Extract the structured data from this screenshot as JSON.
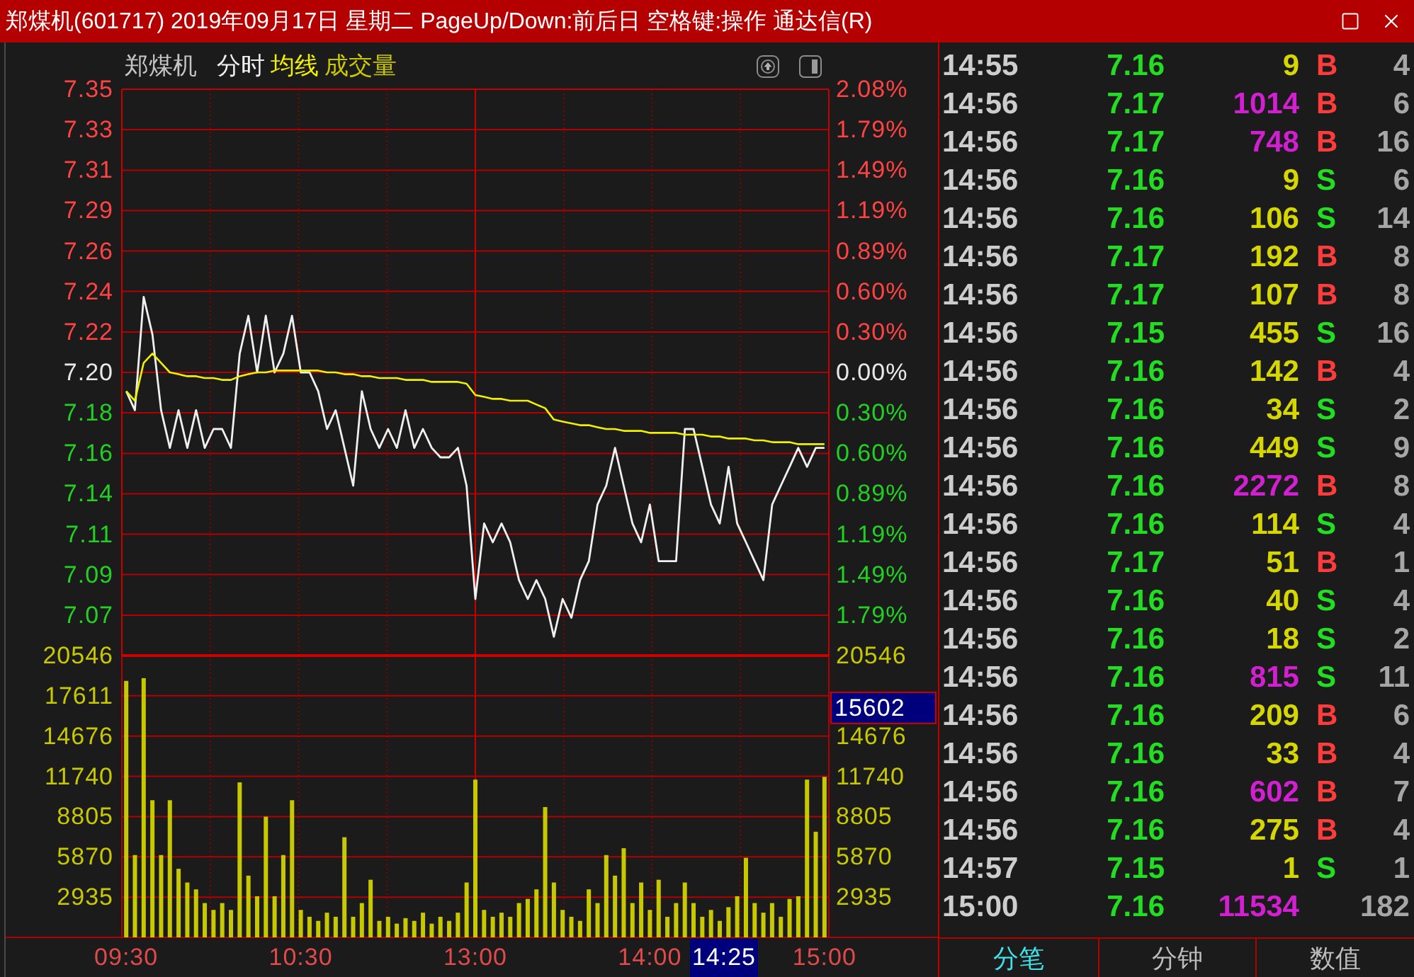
{
  "window": {
    "title": "郑煤机(601717) 2019年09月17日 星期二 PageUp/Down:前后日 空格键:操作 通达信(R)"
  },
  "chart_header": {
    "stock_name": "郑煤机"
  },
  "price_chart": {
    "chart_data": {
      "type": "line",
      "grid": true,
      "categories": [
        null,
        null,
        null,
        null,
        null,
        null,
        null,
        null,
        null,
        null,
        null,
        null,
        null,
        null,
        null,
        null,
        null,
        null,
        null,
        null,
        null,
        null,
        null,
        null,
        null,
        null,
        null,
        null,
        null,
        null,
        null,
        null,
        null,
        null,
        null,
        null,
        null,
        null,
        null,
        null,
        null,
        null,
        null,
        null,
        null,
        null,
        null,
        null,
        null,
        null,
        null,
        null,
        null,
        null,
        null,
        null,
        null,
        null,
        null,
        null,
        null,
        null,
        null,
        null,
        null,
        null,
        null,
        null,
        null,
        null,
        null,
        null,
        null,
        null,
        null,
        null,
        null,
        null,
        null,
        null,
        null
      ],
      "ylim": [
        7.05,
        7.35
      ],
      "yticks": [
        {
          "value": 7.35,
          "label": "7.35"
        },
        {
          "value": 7.3286,
          "label": "7.33"
        },
        {
          "value": 7.3071,
          "label": "7.31"
        },
        {
          "value": 7.2857,
          "label": "7.29"
        },
        {
          "value": 7.2643,
          "label": "7.26"
        },
        {
          "value": 7.2429,
          "label": "7.24"
        },
        {
          "value": 7.2214,
          "label": "7.22"
        },
        {
          "value": 7.2,
          "label": "7.20"
        },
        {
          "value": 7.1786,
          "label": "7.18"
        },
        {
          "value": 7.1571,
          "label": "7.16"
        },
        {
          "value": 7.1357,
          "label": "7.14"
        },
        {
          "value": 7.1143,
          "label": "7.11"
        },
        {
          "value": 7.0929,
          "label": "7.09"
        },
        {
          "value": 7.0714,
          "label": "7.07"
        }
      ],
      "series": [
        {
          "name": "分时",
          "color": "#f0f0f0",
          "values": [
            7.19,
            7.18,
            7.24,
            7.22,
            7.18,
            7.16,
            7.18,
            7.16,
            7.18,
            7.16,
            7.17,
            7.17,
            7.16,
            7.21,
            7.23,
            7.2,
            7.23,
            7.2,
            7.21,
            7.23,
            7.2,
            7.2,
            7.19,
            7.17,
            7.18,
            7.16,
            7.14,
            7.19,
            7.17,
            7.16,
            7.17,
            7.16,
            7.18,
            7.16,
            7.17,
            7.16,
            7.155,
            7.155,
            7.16,
            7.14,
            7.08,
            7.12,
            7.11,
            7.12,
            7.11,
            7.09,
            7.08,
            7.09,
            7.08,
            7.06,
            7.08,
            7.07,
            7.09,
            7.1,
            7.13,
            7.14,
            7.16,
            7.14,
            7.12,
            7.11,
            7.13,
            7.1,
            7.1,
            7.1,
            7.17,
            7.17,
            7.15,
            7.13,
            7.12,
            7.15,
            7.12,
            7.11,
            7.1,
            7.09,
            7.13,
            7.14,
            7.15,
            7.16,
            7.15,
            7.16,
            7.16
          ]
        },
        {
          "name": "均线",
          "color": "#f0f000",
          "values": [
            7.19,
            7.185,
            7.205,
            7.21,
            7.205,
            7.2,
            7.199,
            7.198,
            7.198,
            7.197,
            7.197,
            7.196,
            7.196,
            7.198,
            7.199,
            7.2,
            7.2,
            7.201,
            7.201,
            7.201,
            7.201,
            7.201,
            7.201,
            7.2,
            7.2,
            7.199,
            7.199,
            7.198,
            7.198,
            7.197,
            7.197,
            7.197,
            7.196,
            7.196,
            7.196,
            7.195,
            7.195,
            7.195,
            7.195,
            7.194,
            7.188,
            7.187,
            7.186,
            7.186,
            7.185,
            7.185,
            7.185,
            7.183,
            7.181,
            7.175,
            7.174,
            7.173,
            7.172,
            7.172,
            7.171,
            7.17,
            7.17,
            7.169,
            7.169,
            7.169,
            7.168,
            7.168,
            7.168,
            7.168,
            7.167,
            7.167,
            7.167,
            7.166,
            7.166,
            7.165,
            7.165,
            7.165,
            7.164,
            7.164,
            7.163,
            7.163,
            7.163,
            7.162,
            7.162,
            7.162,
            7.162
          ]
        }
      ]
    },
    "percent_labels": [
      {
        "text": "2.08%",
        "kind": "up"
      },
      {
        "text": "1.79%",
        "kind": "up"
      },
      {
        "text": "1.49%",
        "kind": "up"
      },
      {
        "text": "1.19%",
        "kind": "up"
      },
      {
        "text": "0.89%",
        "kind": "up"
      },
      {
        "text": "0.60%",
        "kind": "up"
      },
      {
        "text": "0.30%",
        "kind": "up"
      },
      {
        "text": "0.00%",
        "kind": "base"
      },
      {
        "text": "0.30%",
        "kind": "down"
      },
      {
        "text": "0.60%",
        "kind": "down"
      },
      {
        "text": "0.89%",
        "kind": "down"
      },
      {
        "text": "1.19%",
        "kind": "down"
      },
      {
        "text": "1.49%",
        "kind": "down"
      },
      {
        "text": "1.79%",
        "kind": "down"
      }
    ]
  },
  "volume_chart": {
    "chart_data": {
      "type": "bar",
      "grid": true,
      "categories": [
        "09:30",
        null,
        null,
        null,
        null,
        null,
        null,
        null,
        null,
        null,
        null,
        null,
        null,
        null,
        null,
        null,
        null,
        null,
        null,
        null,
        "10:30",
        null,
        null,
        null,
        null,
        null,
        null,
        null,
        null,
        null,
        null,
        null,
        null,
        null,
        null,
        null,
        null,
        null,
        null,
        null,
        "13:00",
        null,
        null,
        null,
        null,
        null,
        null,
        null,
        null,
        null,
        null,
        null,
        null,
        null,
        null,
        null,
        null,
        null,
        null,
        null,
        "14:00",
        null,
        null,
        null,
        null,
        null,
        null,
        null,
        null,
        null,
        null,
        null,
        null,
        null,
        null,
        null,
        null,
        null,
        null,
        null,
        "15:00"
      ],
      "ylim": [
        0,
        20546
      ],
      "yticks": [
        20546,
        17611,
        14676,
        11740,
        8805,
        5870,
        2935
      ],
      "series": [
        {
          "name": "成交量",
          "color": "#c8c800",
          "values": [
            18700,
            6000,
            18900,
            10000,
            6000,
            10000,
            5000,
            4000,
            3500,
            2500,
            2000,
            2500,
            2000,
            11300,
            4500,
            3000,
            8800,
            3000,
            6000,
            10000,
            2000,
            1500,
            1200,
            1800,
            1500,
            7300,
            1500,
            2500,
            4200,
            1200,
            1500,
            1000,
            1400,
            1200,
            1800,
            1000,
            1500,
            1200,
            1800,
            4000,
            11500,
            2000,
            1500,
            1800,
            1500,
            2500,
            2800,
            3500,
            9500,
            4000,
            2000,
            1500,
            1200,
            3500,
            2500,
            6000,
            4500,
            6500,
            2500,
            4000,
            2000,
            4200,
            1500,
            2500,
            4000,
            2500,
            1500,
            2000,
            1200,
            2200,
            3000,
            5800,
            2500,
            1800,
            2500,
            1500,
            2800,
            3000,
            11500,
            7700,
            11700
          ]
        }
      ]
    },
    "right_axis": [
      {
        "kind": "label",
        "text": "20546"
      },
      {
        "kind": "cursor",
        "text": "15602"
      },
      {
        "kind": "label",
        "text": "14676"
      },
      {
        "kind": "label",
        "text": "11740"
      },
      {
        "kind": "label",
        "text": "8805"
      },
      {
        "kind": "label",
        "text": "5870"
      },
      {
        "kind": "label",
        "text": "2935"
      }
    ],
    "cursor_time": "14:25"
  },
  "trades": [
    {
      "time": "14:55",
      "price": "7.16",
      "volume": "9",
      "large": false,
      "side": "B",
      "color": "#ff3c3c",
      "count": "4"
    },
    {
      "time": "14:56",
      "price": "7.17",
      "volume": "1014",
      "large": true,
      "side": "B",
      "color": "#ff3c3c",
      "count": "6"
    },
    {
      "time": "14:56",
      "price": "7.17",
      "volume": "748",
      "large": true,
      "side": "B",
      "color": "#ff3c3c",
      "count": "16"
    },
    {
      "time": "14:56",
      "price": "7.16",
      "volume": "9",
      "large": false,
      "side": "S",
      "color": "#22dd22",
      "count": "6"
    },
    {
      "time": "14:56",
      "price": "7.16",
      "volume": "106",
      "large": false,
      "side": "S",
      "color": "#22dd22",
      "count": "14"
    },
    {
      "time": "14:56",
      "price": "7.17",
      "volume": "192",
      "large": false,
      "side": "B",
      "color": "#ff3c3c",
      "count": "8"
    },
    {
      "time": "14:56",
      "price": "7.17",
      "volume": "107",
      "large": false,
      "side": "B",
      "color": "#ff3c3c",
      "count": "8"
    },
    {
      "time": "14:56",
      "price": "7.15",
      "volume": "455",
      "large": false,
      "side": "S",
      "color": "#22dd22",
      "count": "16"
    },
    {
      "time": "14:56",
      "price": "7.16",
      "volume": "142",
      "large": false,
      "side": "B",
      "color": "#ff3c3c",
      "count": "4"
    },
    {
      "time": "14:56",
      "price": "7.16",
      "volume": "34",
      "large": false,
      "side": "S",
      "color": "#22dd22",
      "count": "2"
    },
    {
      "time": "14:56",
      "price": "7.16",
      "volume": "449",
      "large": false,
      "side": "S",
      "color": "#22dd22",
      "count": "9"
    },
    {
      "time": "14:56",
      "price": "7.16",
      "volume": "2272",
      "large": true,
      "side": "B",
      "color": "#ff3c3c",
      "count": "8"
    },
    {
      "time": "14:56",
      "price": "7.16",
      "volume": "114",
      "large": false,
      "side": "S",
      "color": "#22dd22",
      "count": "4"
    },
    {
      "time": "14:56",
      "price": "7.17",
      "volume": "51",
      "large": false,
      "side": "B",
      "color": "#ff3c3c",
      "count": "1"
    },
    {
      "time": "14:56",
      "price": "7.16",
      "volume": "40",
      "large": false,
      "side": "S",
      "color": "#22dd22",
      "count": "4"
    },
    {
      "time": "14:56",
      "price": "7.16",
      "volume": "18",
      "large": false,
      "side": "S",
      "color": "#22dd22",
      "count": "2"
    },
    {
      "time": "14:56",
      "price": "7.16",
      "volume": "815",
      "large": true,
      "side": "S",
      "color": "#22dd22",
      "count": "11"
    },
    {
      "time": "14:56",
      "price": "7.16",
      "volume": "209",
      "large": false,
      "side": "B",
      "color": "#ff3c3c",
      "count": "6"
    },
    {
      "time": "14:56",
      "price": "7.16",
      "volume": "33",
      "large": false,
      "side": "B",
      "color": "#ff3c3c",
      "count": "4"
    },
    {
      "time": "14:56",
      "price": "7.16",
      "volume": "602",
      "large": true,
      "side": "B",
      "color": "#ff3c3c",
      "count": "7"
    },
    {
      "time": "14:56",
      "price": "7.16",
      "volume": "275",
      "large": false,
      "side": "B",
      "color": "#ff3c3c",
      "count": "4"
    },
    {
      "time": "14:57",
      "price": "7.15",
      "volume": "1",
      "large": false,
      "side": "S",
      "color": "#22dd22",
      "count": "1"
    },
    {
      "time": "15:00",
      "price": "7.16",
      "volume": "11534",
      "large": true,
      "count": "182"
    }
  ],
  "tabs": [
    {
      "label": "分笔",
      "selected": true
    },
    {
      "label": "分钟",
      "selected": false
    },
    {
      "label": "数值",
      "selected": false
    }
  ]
}
